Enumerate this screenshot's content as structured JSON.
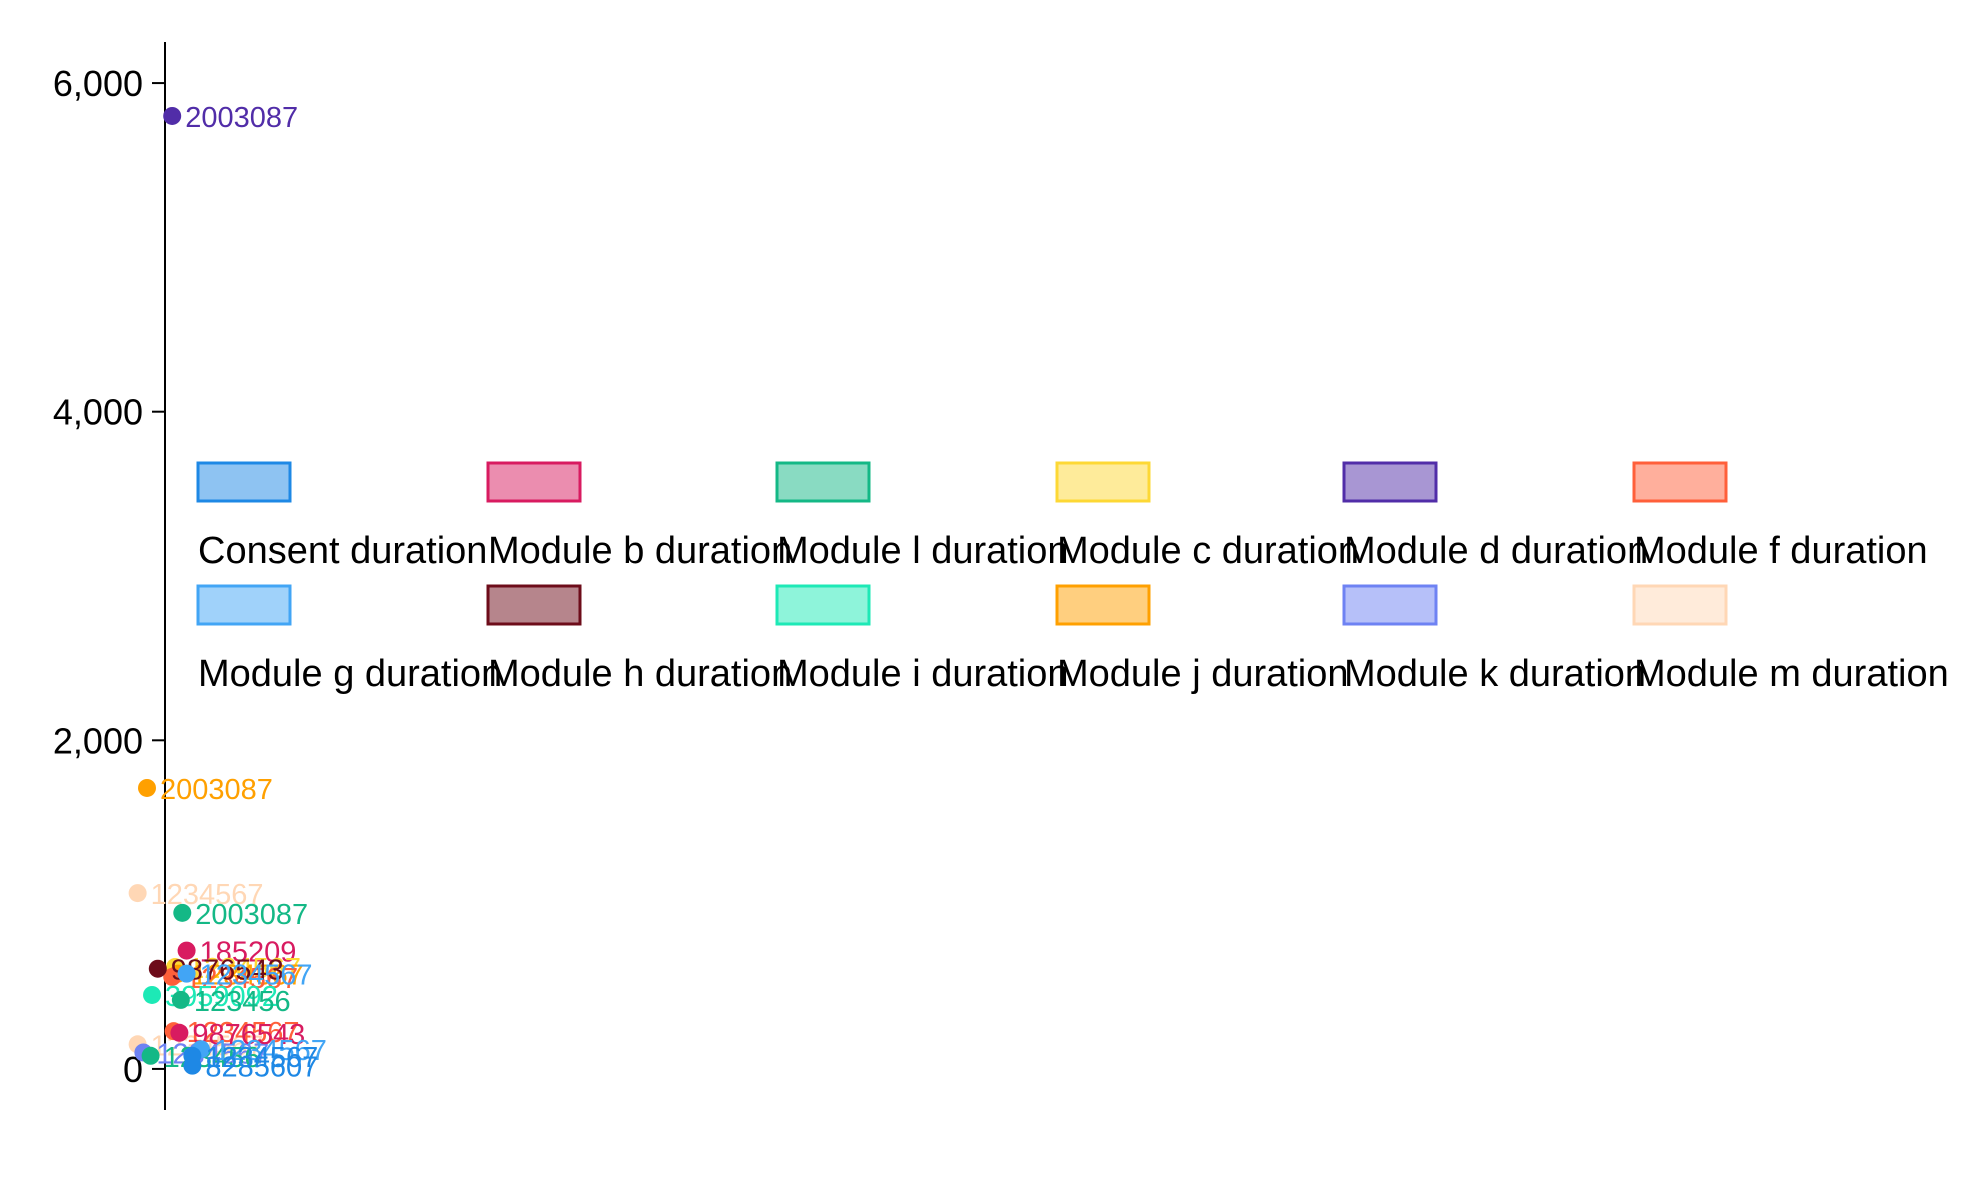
{
  "colors": {
    "consent": "#1e88e5",
    "module_b": "#d81b60",
    "module_l": "#14b886",
    "module_c": "#fdd835",
    "module_d": "#512da8",
    "module_f": "#ff5f3a",
    "module_g": "#42a5f5",
    "module_h": "#6d0c1a",
    "module_i": "#1de9b6",
    "module_j": "#ffa000",
    "module_k": "#6e82f3",
    "module_m": "#ffd7b5"
  },
  "chart_data": {
    "type": "scatter",
    "title": "",
    "xlabel": "",
    "ylabel": "",
    "ylim": [
      -250,
      6250
    ],
    "yticks": [
      0,
      2000,
      4000,
      6000
    ],
    "ytick_labels": [
      "0",
      "2,000",
      "4,000",
      "6,000"
    ],
    "x_axis_shown": false,
    "grid": false,
    "legend_position": "middle",
    "legend": [
      {
        "label": "Consent duration",
        "color_key": "consent"
      },
      {
        "label": "Module b duration",
        "color_key": "module_b"
      },
      {
        "label": "Module l duration",
        "color_key": "module_l"
      },
      {
        "label": "Module c duration",
        "color_key": "module_c"
      },
      {
        "label": "Module d duration",
        "color_key": "module_d"
      },
      {
        "label": "Module f duration",
        "color_key": "module_f"
      },
      {
        "label": "Module g duration",
        "color_key": "module_g"
      },
      {
        "label": "Module h duration",
        "color_key": "module_h"
      },
      {
        "label": "Module i duration",
        "color_key": "module_i"
      },
      {
        "label": "Module j duration",
        "color_key": "module_j"
      },
      {
        "label": "Module k duration",
        "color_key": "module_k"
      },
      {
        "label": "Module m duration",
        "color_key": "module_m"
      }
    ],
    "points": [
      {
        "series": "module_m",
        "x": -0.38,
        "y": 150,
        "label": "1234567"
      },
      {
        "series": "module_k",
        "x": -0.3,
        "y": 100,
        "label": "1234567"
      },
      {
        "series": "module_l",
        "x": -0.2,
        "y": 80,
        "label": "123456"
      },
      {
        "series": "module_f",
        "x": 0.12,
        "y": 230,
        "label": "1234567"
      },
      {
        "series": "module_b",
        "x": 0.2,
        "y": 220,
        "label": "9876543"
      },
      {
        "series": "module_g",
        "x": 0.5,
        "y": 120,
        "label": "1234567"
      },
      {
        "series": "module_m",
        "x": -0.38,
        "y": 1070,
        "label": "1234567"
      },
      {
        "series": "module_j",
        "x": -0.25,
        "y": 1710,
        "label": "2003087"
      },
      {
        "series": "module_l",
        "x": 0.24,
        "y": 950,
        "label": "2003087"
      },
      {
        "series": "module_b",
        "x": 0.3,
        "y": 720,
        "label": "185209"
      },
      {
        "series": "module_c",
        "x": 0.14,
        "y": 620,
        "label": "1234567"
      },
      {
        "series": "module_j",
        "x": 0.18,
        "y": 580,
        "label": "1234567"
      },
      {
        "series": "module_f",
        "x": 0.1,
        "y": 560,
        "label": "1234567"
      },
      {
        "series": "module_h",
        "x": -0.1,
        "y": 610,
        "label": "9876543"
      },
      {
        "series": "module_i",
        "x": -0.18,
        "y": 450,
        "label": "3959092"
      },
      {
        "series": "module_l",
        "x": 0.22,
        "y": 420,
        "label": "123456"
      },
      {
        "series": "module_g",
        "x": 0.3,
        "y": 580,
        "label": "1234567"
      },
      {
        "series": "module_d",
        "x": 0.1,
        "y": 5800,
        "label": "2003087"
      },
      {
        "series": "consent",
        "x": 0.38,
        "y": 80,
        "label": "1234567"
      },
      {
        "series": "consent",
        "x": 0.38,
        "y": 20,
        "label": "8285607"
      }
    ]
  }
}
